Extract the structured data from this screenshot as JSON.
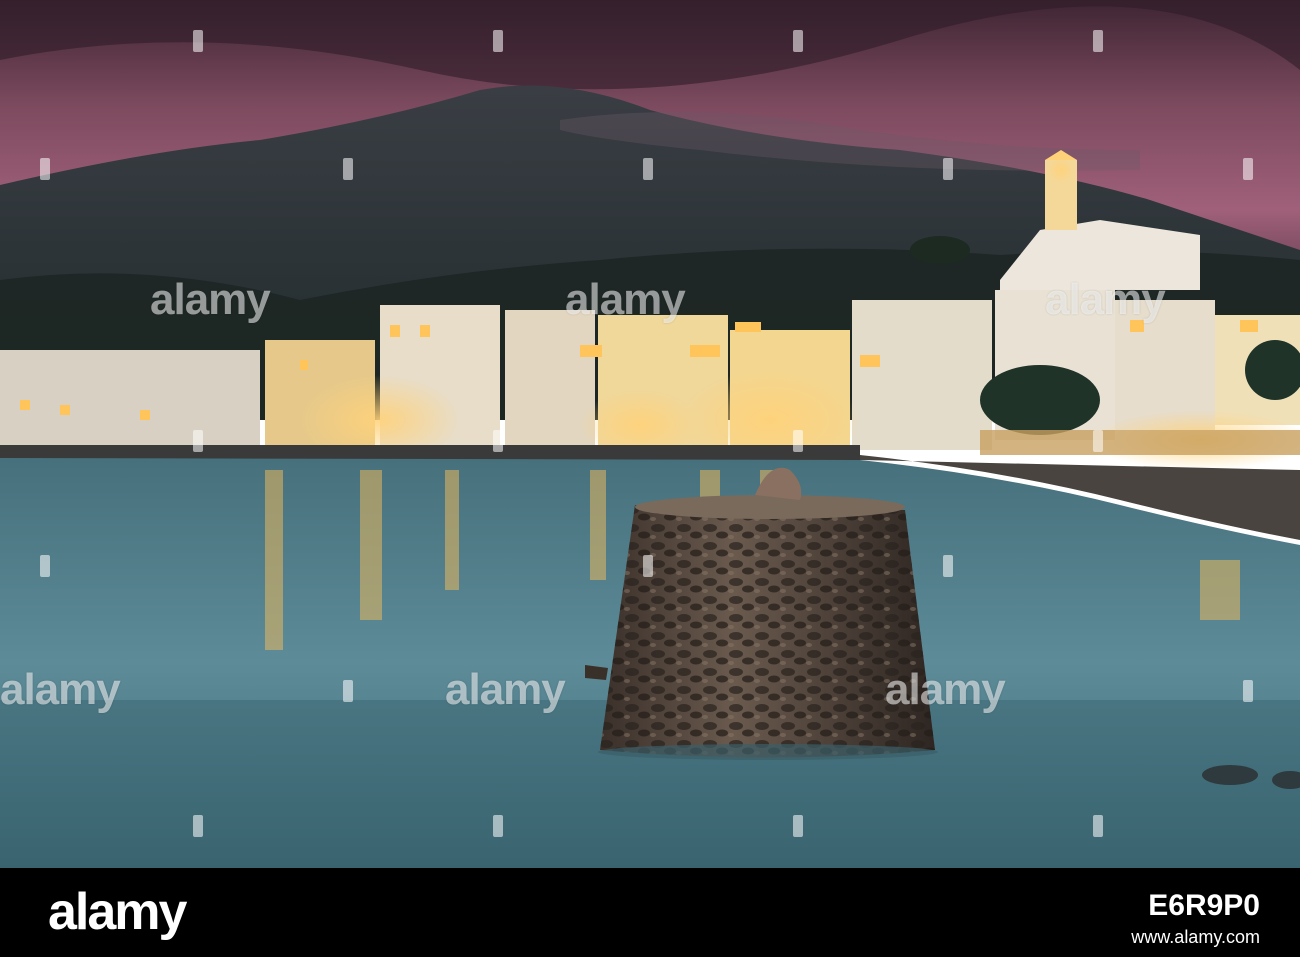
{
  "image": {
    "subject": "Coastal town at dusk with an illuminated church and a stone bollard in calm water",
    "colors": {
      "sky_top": "#4a2e3c",
      "sky_glow": "#9a5a72",
      "mountain": "#2a3236",
      "water": "#5f8a98",
      "building_white": "#e8dcc8",
      "lights": "#ffc45a",
      "stone": "#4a3e36"
    }
  },
  "watermark": {
    "text": "alamy"
  },
  "footer": {
    "logo": "alamy",
    "caption_line_1": "",
    "caption_line_2": "",
    "image_id": "E6R9P0",
    "site": "www.alamy.com"
  }
}
